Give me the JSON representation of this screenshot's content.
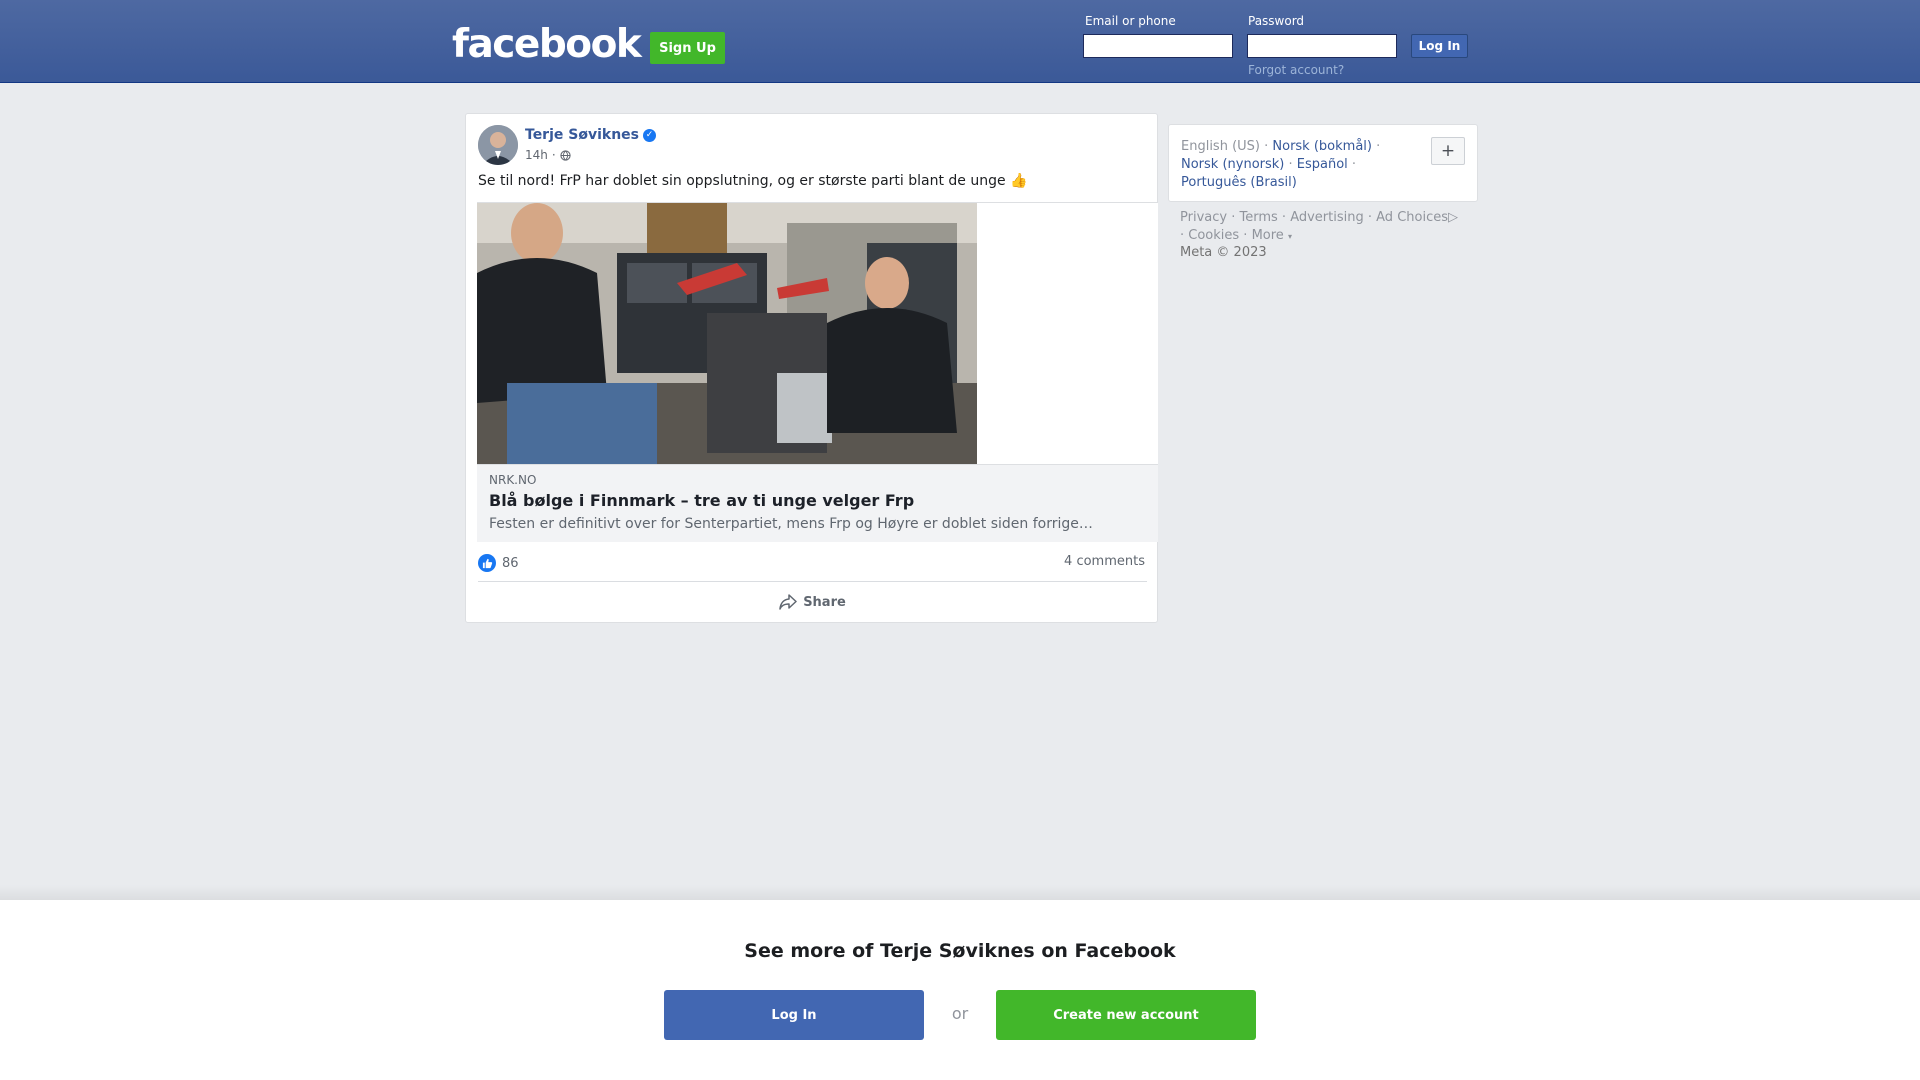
{
  "header": {
    "logo": "facebook",
    "signup_label": "Sign Up",
    "email_label": "Email or phone",
    "email_value": "",
    "password_label": "Password",
    "password_value": "",
    "login_label": "Log In",
    "forgot_label": "Forgot account?"
  },
  "post": {
    "author": "Terje Søviknes",
    "verified_icon": "verified-badge-icon",
    "time": "14h",
    "separator": "·",
    "privacy_icon": "globe-icon",
    "text": "Se til nord! FrP har doblet sin oppslutning, og er største parti blant de unge 👍",
    "link": {
      "domain": "NRK.NO",
      "title": "Blå bølge i Finnmark – tre av ti unge velger Frp",
      "description": "Festen er definitivt over for Senterpartiet, mens Frp og Høyre er doblet siden forrige…"
    },
    "likes": "86",
    "comments": "4 comments",
    "share_label": "Share"
  },
  "sidebar": {
    "languages": [
      {
        "label": "English (US)",
        "current": true
      },
      {
        "label": "Norsk (bokmål)",
        "current": false
      },
      {
        "label": "Norsk (nynorsk)",
        "current": false
      },
      {
        "label": "Español",
        "current": false
      },
      {
        "label": "Português (Brasil)",
        "current": false
      }
    ],
    "plus_label": "+",
    "footer": {
      "privacy": "Privacy",
      "terms": "Terms",
      "advertising": "Advertising",
      "ad_choices": "Ad Choices",
      "cookies": "Cookies",
      "more": "More"
    },
    "copyright": "Meta © 2023"
  },
  "bottom": {
    "title": "See more of Terje Søviknes on Facebook",
    "login_label": "Log In",
    "or_label": "or",
    "create_label": "Create new account"
  },
  "colors": {
    "header_blue": "#3b5998",
    "link_blue": "#365899",
    "green": "#42b72a",
    "page_bg": "#e9ebee"
  }
}
